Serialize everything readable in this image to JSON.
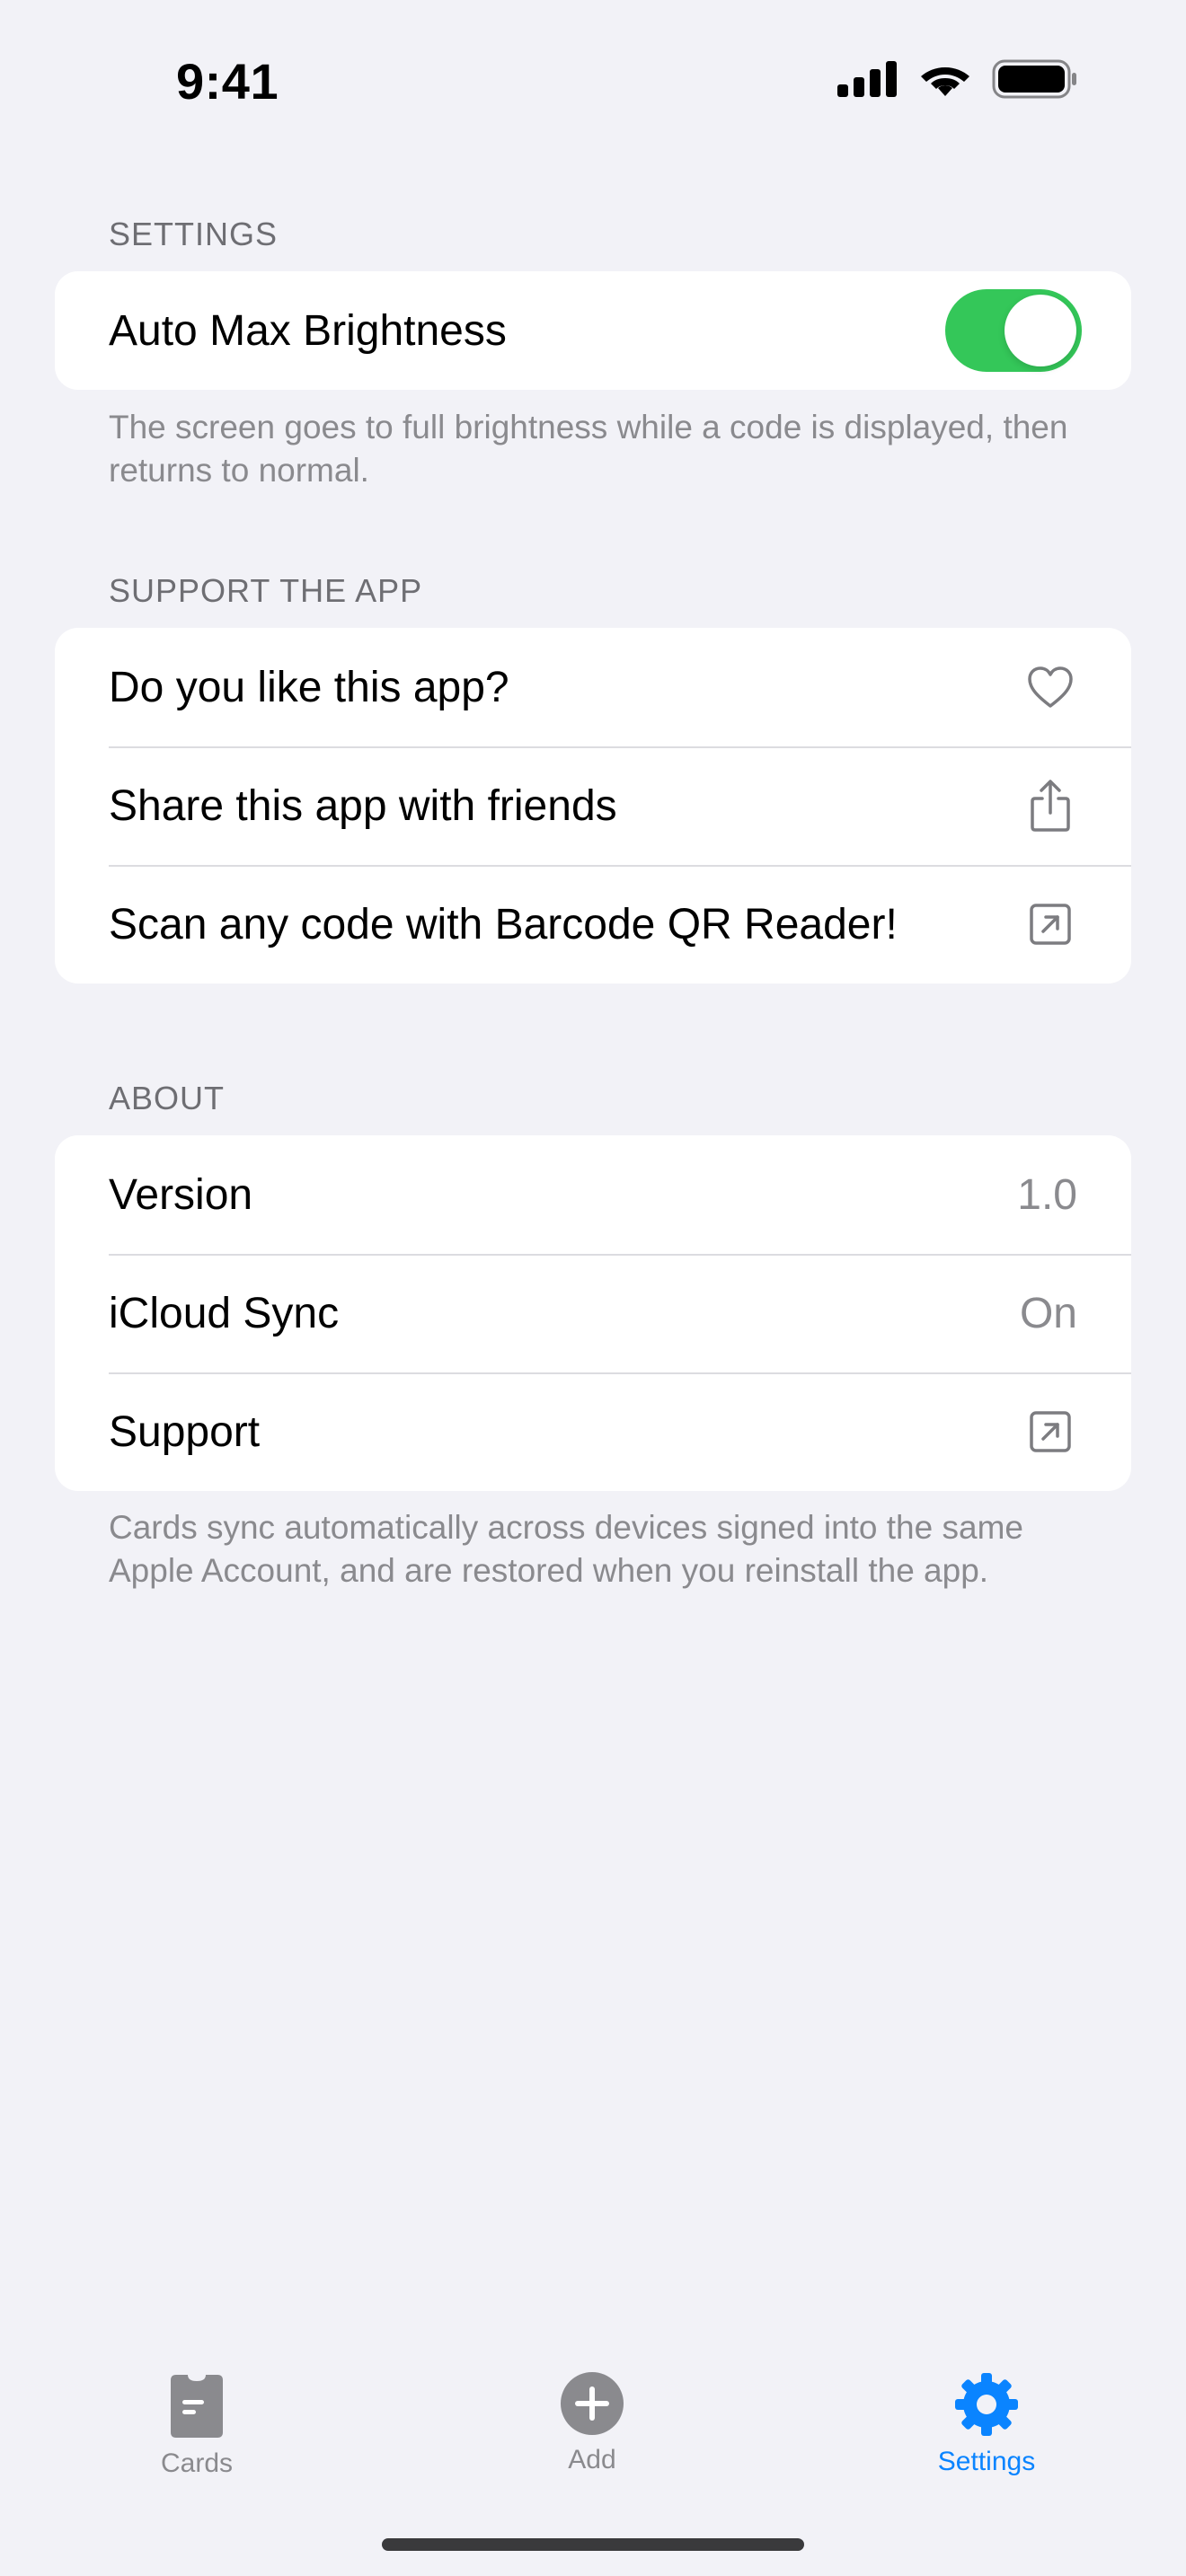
{
  "status_bar": {
    "time": "9:41"
  },
  "settings_section": {
    "header": "SETTINGS",
    "auto_brightness": {
      "label": "Auto Max Brightness",
      "enabled": true
    },
    "footer": "The screen goes to full brightness while a code is displayed, then returns to normal."
  },
  "support_section": {
    "header": "SUPPORT THE APP",
    "items": [
      {
        "label": "Do you like this app?",
        "icon": "heart-icon"
      },
      {
        "label": "Share this app with friends",
        "icon": "share-icon"
      },
      {
        "label": "Scan any code with Barcode QR Reader!",
        "icon": "external-link-icon"
      }
    ]
  },
  "about_section": {
    "header": "ABOUT",
    "version": {
      "label": "Version",
      "value": "1.0"
    },
    "icloud": {
      "label": "iCloud Sync",
      "value": "On"
    },
    "support": {
      "label": "Support",
      "icon": "external-link-icon"
    },
    "footer": "Cards sync automatically across devices signed into the same Apple Account, and are restored when you reinstall the app."
  },
  "tab_bar": {
    "tabs": [
      {
        "label": "Cards",
        "icon": "cards-icon",
        "active": false
      },
      {
        "label": "Add",
        "icon": "add-circle-icon",
        "active": false
      },
      {
        "label": "Settings",
        "icon": "gear-icon",
        "active": true
      }
    ]
  },
  "colors": {
    "background": "#F2F2F7",
    "toggle_on": "#34C759",
    "accent": "#0A84FF",
    "inactive_tab": "#8A8A8E"
  }
}
